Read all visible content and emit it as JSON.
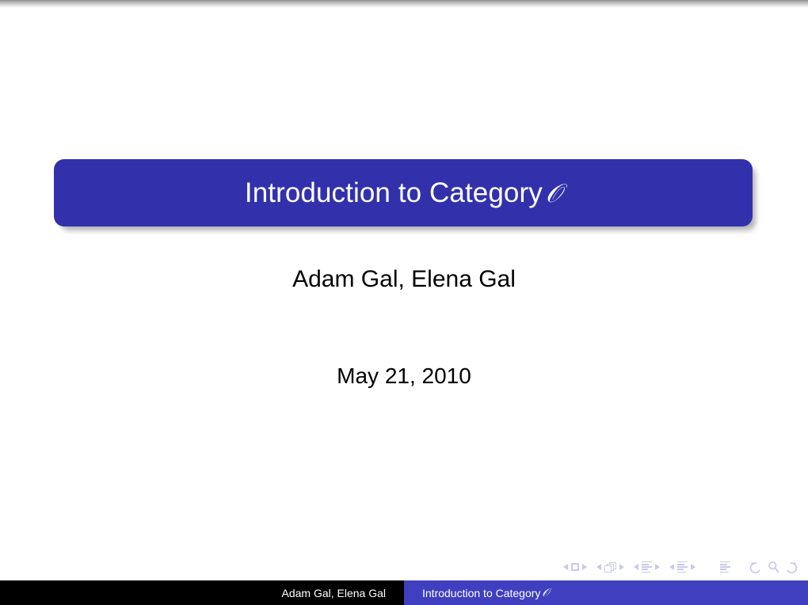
{
  "slide": {
    "kind": "beamer-title-slide",
    "background_color": "#ffffff"
  },
  "title_block": {
    "title_main": "Introduction to Category",
    "title_symbol": "𝒪",
    "background_color": "#3231ab",
    "text_color": "#ffffff"
  },
  "authors": {
    "line": "Adam Gal, Elena Gal"
  },
  "date": {
    "line": "May 21, 2010"
  },
  "navigation": {
    "color": "#c9c9e8",
    "items": [
      {
        "name": "previous-slide",
        "label": "◀"
      },
      {
        "name": "slide-indicator",
        "label": "slide"
      },
      {
        "name": "next-slide",
        "label": "▶"
      },
      {
        "name": "previous-frame",
        "label": "◀"
      },
      {
        "name": "frame-indicator",
        "label": "frame"
      },
      {
        "name": "next-frame",
        "label": "▶"
      },
      {
        "name": "previous-subsection",
        "label": "◀"
      },
      {
        "name": "subsection-indicator",
        "label": "subsection"
      },
      {
        "name": "next-subsection",
        "label": "▶"
      },
      {
        "name": "previous-section",
        "label": "◀"
      },
      {
        "name": "section-indicator",
        "label": "section"
      },
      {
        "name": "next-section",
        "label": "▶"
      },
      {
        "name": "document-indicator",
        "label": "document"
      },
      {
        "name": "back",
        "label": "back"
      },
      {
        "name": "find",
        "label": "find"
      },
      {
        "name": "forward",
        "label": "forward"
      }
    ]
  },
  "footline": {
    "author_text": "Adam Gal, Elena Gal",
    "title_text": "Introduction to Category",
    "title_symbol": "𝒪",
    "author_background": "#000000",
    "title_background": "#3f3fbf",
    "text_color": "#ffffff"
  }
}
